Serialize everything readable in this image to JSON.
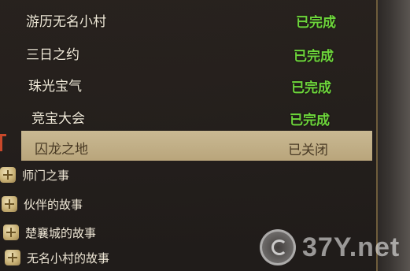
{
  "quests": [
    {
      "name": "游历无名小村",
      "status": "已完成"
    },
    {
      "name": "三日之约",
      "status": "已完成"
    },
    {
      "name": "珠光宝气",
      "status": "已完成"
    },
    {
      "name": "竞宝大会",
      "status": "已完成"
    },
    {
      "name": "囚龙之地",
      "status": "已关闭"
    }
  ],
  "categories": [
    {
      "label": "师门之事"
    },
    {
      "label": "伙伴的故事"
    },
    {
      "label": "楚襄城的故事"
    },
    {
      "label": "无名小村的故事"
    }
  ],
  "colors": {
    "completed": "#6dd53b",
    "selected_bg": "#c4b38b",
    "text": "#f1ead9"
  },
  "watermark": {
    "text": "37Y.net"
  }
}
